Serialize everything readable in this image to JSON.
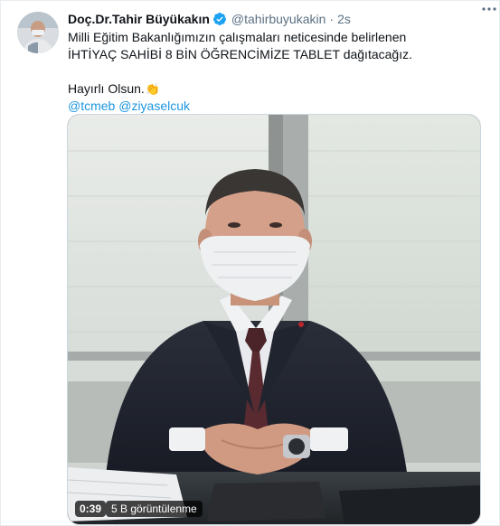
{
  "tweet": {
    "author_name": "Doç.Dr.Tahir Büyükakın",
    "handle": "@tahirbuyukakin",
    "separator": "·",
    "time": "2s",
    "text_line1": "Milli Eğitim Bakanlığımızın çalışmaları neticesinde belirlenen",
    "text_line2": "İHTİYAÇ SAHİBİ 8 BİN ÖĞRENCİMİZE TABLET dağıtacağız.",
    "text_line3": "Hayırlı Olsun.",
    "emoji": "👏",
    "mentions": [
      "@tcmeb",
      "@ziyaselcuk"
    ]
  },
  "video": {
    "duration": "0:39",
    "views": "5 B görüntülenme"
  },
  "colors": {
    "link": "#1b95e0",
    "verified": "#1da1f2",
    "muted": "#5b7083",
    "text": "#0f1419"
  },
  "icons": {
    "verified": "verified-badge-icon",
    "more": "more-options-icon"
  }
}
